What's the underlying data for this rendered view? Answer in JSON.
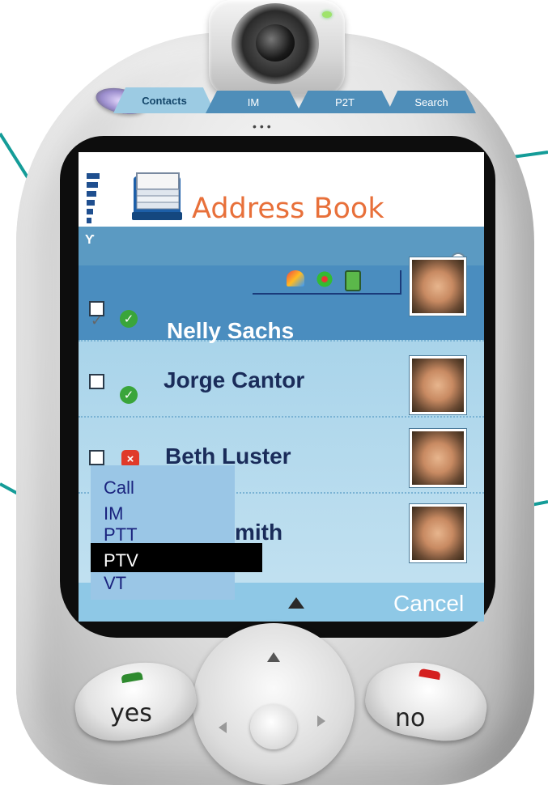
{
  "app": {
    "title": "Address Book"
  },
  "tabs": [
    {
      "label": "Contacts",
      "active": true
    },
    {
      "label": "IM",
      "active": false
    },
    {
      "label": "P2T",
      "active": false
    },
    {
      "label": "Search",
      "active": false
    }
  ],
  "contacts": [
    {
      "name": "Nelly Sachs",
      "status": "online",
      "checked": true,
      "selected": true
    },
    {
      "name": "Jorge Cantor",
      "status": "online",
      "checked": false,
      "selected": false
    },
    {
      "name": "Beth Luster",
      "status": "offline",
      "checked": false,
      "selected": false
    },
    {
      "name": "mith",
      "status": "online",
      "checked": false,
      "selected": false
    }
  ],
  "context_menu": {
    "items": [
      "Call",
      "IM",
      "PTT",
      "PTV",
      "VT"
    ],
    "highlighted": "PTV"
  },
  "softkeys": {
    "right": "Cancel"
  },
  "keys": {
    "yes": "yes",
    "no": "no"
  },
  "page_fragment": ",",
  "colors": {
    "title": "#e8703a",
    "selected_row": "#4a8dbf",
    "callout_line": "#149c98",
    "online": "#3aa53a",
    "offline": "#e03a2a",
    "menu_bg": "#9ac6e6",
    "menu_text": "#1a237e"
  }
}
